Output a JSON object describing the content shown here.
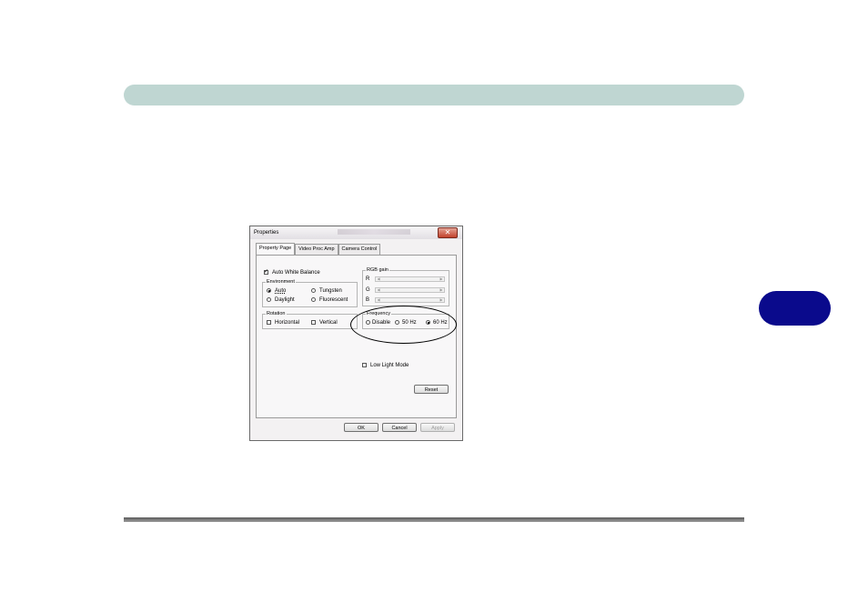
{
  "colors": {
    "header_bar": "#bfd6d2",
    "chapter_tab": "#0a0a8c",
    "footer_rule": "#666666"
  },
  "dialog": {
    "title": "Properties",
    "close_glyph": "✕",
    "tabs": [
      {
        "label": "Property Page",
        "active": true
      },
      {
        "label": "Video Proc Amp",
        "active": false
      },
      {
        "label": "Camera Control",
        "active": false
      }
    ],
    "auto_white_balance": {
      "label": "Auto White Balance",
      "checked": true
    },
    "environment": {
      "title": "Environment",
      "options": [
        {
          "label": "Auto",
          "selected": true
        },
        {
          "label": "Tungsten",
          "selected": false
        },
        {
          "label": "Daylight",
          "selected": false
        },
        {
          "label": "Fluorescent",
          "selected": false
        }
      ]
    },
    "rotation": {
      "title": "Rotation",
      "horizontal": {
        "label": "Horizontal",
        "checked": false
      },
      "vertical": {
        "label": "Vertical",
        "checked": false
      }
    },
    "rgb_gain": {
      "title": "RGB gain",
      "channels": [
        {
          "label": "R"
        },
        {
          "label": "G"
        },
        {
          "label": "B"
        }
      ]
    },
    "frequency": {
      "title": "Frequency",
      "options": [
        {
          "label": "Disable",
          "selected": false
        },
        {
          "label": "50 Hz",
          "selected": false
        },
        {
          "label": "60 Hz",
          "selected": true
        }
      ]
    },
    "low_light_mode": {
      "label": "Low Light Mode",
      "checked": false
    },
    "reset_label": "Reset",
    "ok_label": "OK",
    "cancel_label": "Cancel",
    "apply_label": "Apply"
  }
}
